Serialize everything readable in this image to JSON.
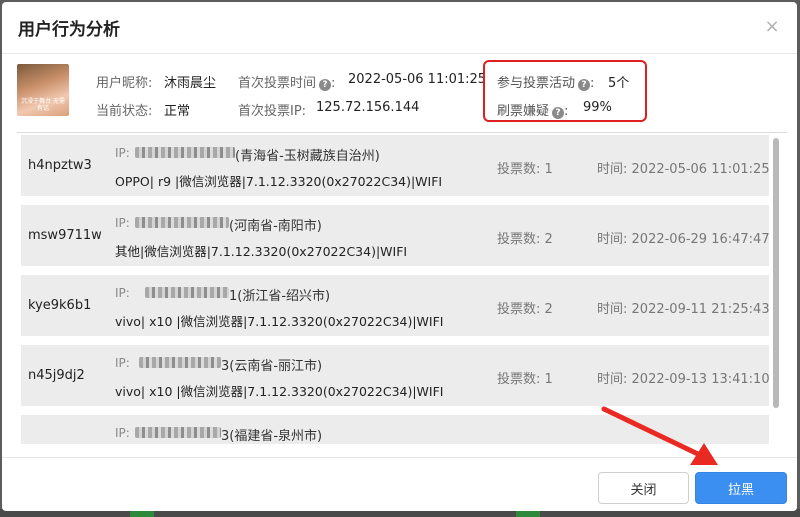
{
  "dialog": {
    "title": "用户行为分析",
    "close_glyph": "×"
  },
  "profile": {
    "avatar_caption": "沉浸于舞台 无需有话",
    "nickname_label": "用户昵称:",
    "nickname": "沐雨晨尘",
    "status_label": "当前状态:",
    "status": "正常",
    "first_vote_time_label": "首次投票时间",
    "first_vote_time": "2022-05-06 11:01:25",
    "first_vote_ip_label": "首次投票IP:",
    "first_vote_ip": "125.72.156.144",
    "activities_label": "参与投票活动",
    "activities": "5个",
    "fraud_label": "刷票嫌疑",
    "fraud": "99%",
    "help_glyph": "?"
  },
  "records": [
    {
      "id": "h4npztw3",
      "ip_label": "IP:",
      "ip_rest": "(青海省-玉树藏族自治州)",
      "device": "OPPO| r9 |微信浏览器|7.1.12.3320(0x27022C34)|WIFI",
      "votes_label": "投票数:",
      "votes": "1",
      "time_label": "时间:",
      "time": "2022-05-06 11:01:25"
    },
    {
      "id": "msw9711w",
      "ip_label": "IP:",
      "ip_rest": "(河南省-南阳市)",
      "device": "其他|微信浏览器|7.1.12.3320(0x27022C34)|WIFI",
      "votes_label": "投票数:",
      "votes": "2",
      "time_label": "时间:",
      "time": "2022-06-29 16:47:47"
    },
    {
      "id": "kye9k6b1",
      "ip_label": "IP:",
      "ip_rest": "1(浙江省-绍兴市)",
      "device": "vivo| x10 |微信浏览器|7.1.12.3320(0x27022C34)|WIFI",
      "votes_label": "投票数:",
      "votes": "2",
      "time_label": "时间:",
      "time": "2022-09-11 21:25:43"
    },
    {
      "id": "n45j9dj2",
      "ip_label": "IP:",
      "ip_rest": "3(云南省-丽江市)",
      "device": "vivo| x10 |微信浏览器|7.1.12.3320(0x27022C34)|WIFI",
      "votes_label": "投票数:",
      "votes": "1",
      "time_label": "时间:",
      "time": "2022-09-13 13:41:10"
    },
    {
      "id": "",
      "ip_label": "IP:",
      "ip_rest": "3(福建省-泉州市)",
      "device": "",
      "votes_label": "",
      "votes": "",
      "time_label": "",
      "time": ""
    }
  ],
  "footer": {
    "close_label": "关闭",
    "block_label": "拉黑"
  },
  "colors": {
    "primary": "#3b8ff0",
    "highlight": "#e0201e",
    "row_bg": "#ececec"
  }
}
